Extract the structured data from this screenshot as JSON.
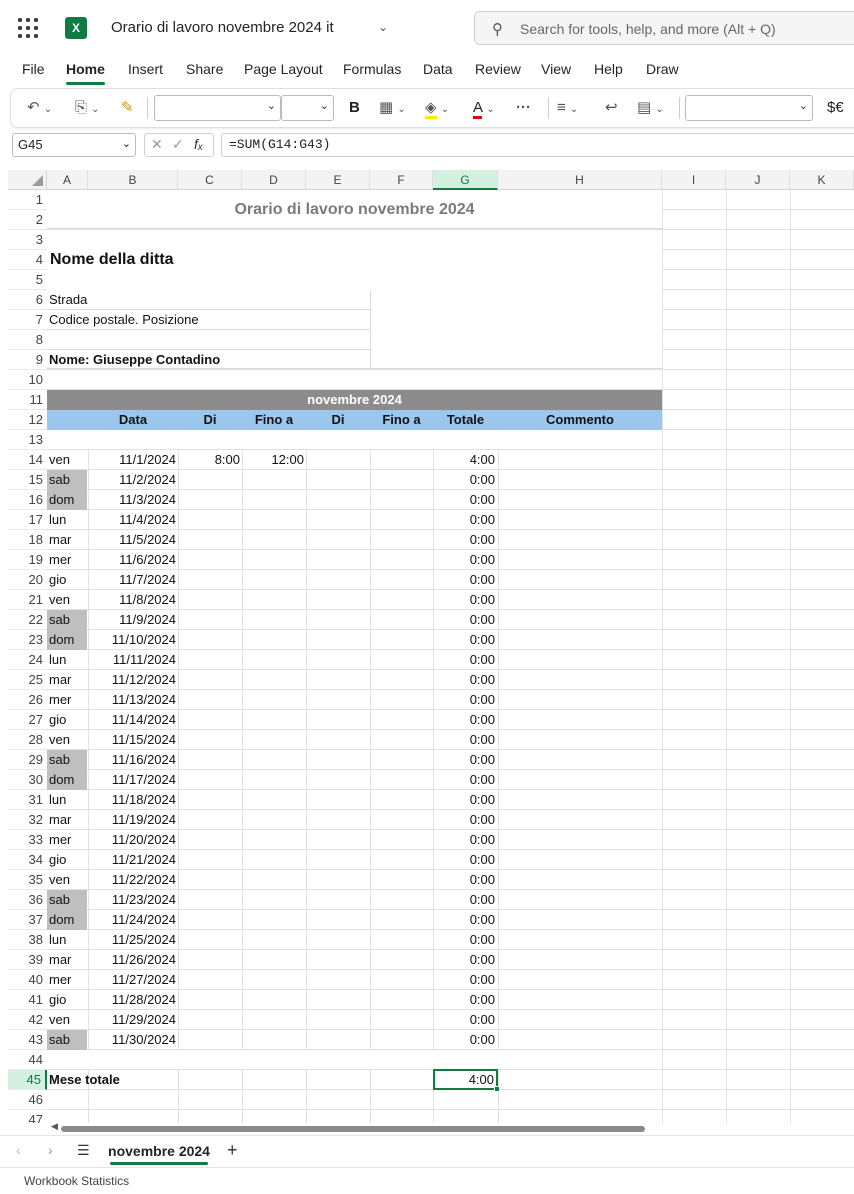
{
  "app": {
    "title": "Orario di lavoro novembre 2024 it",
    "icon": "excel-icon",
    "brand_color": "#107c41"
  },
  "search": {
    "placeholder": "Search for tools, help, and more (Alt + Q)"
  },
  "menu": [
    "File",
    "Home",
    "Insert",
    "Share",
    "Page Layout",
    "Formulas",
    "Data",
    "Review",
    "View",
    "Help",
    "Draw"
  ],
  "menu_active": "Home",
  "toolbar": {
    "bold": "B",
    "more": "···",
    "currency": "$€"
  },
  "formula_bar": {
    "cell_ref": "G45",
    "formula": "=SUM(G14:G43)",
    "fx": "fₓ"
  },
  "columns": [
    "A",
    "B",
    "C",
    "D",
    "E",
    "F",
    "G",
    "H",
    "I",
    "J",
    "K"
  ],
  "selected_column": "G",
  "selected_row": "45",
  "rows": [
    "1",
    "2",
    "3",
    "4",
    "5",
    "6",
    "7",
    "8",
    "9",
    "10",
    "11",
    "12",
    "13",
    "14",
    "15",
    "16",
    "17",
    "18",
    "19",
    "20",
    "21",
    "22",
    "23",
    "24",
    "25",
    "26",
    "27",
    "28",
    "29",
    "30",
    "31",
    "32",
    "33",
    "34",
    "35",
    "36",
    "37",
    "38",
    "39",
    "40",
    "41",
    "42",
    "43",
    "44",
    "45",
    "46",
    "47"
  ],
  "sheet": {
    "title": "Orario di lavoro novembre 2024",
    "company": "Nome della ditta",
    "street": "Strada",
    "postal": "Codice postale. Posizione",
    "name": "Nome: Giuseppe Contadino",
    "month_banner": "novembre 2024",
    "headers": {
      "data": "Data",
      "di": "Di",
      "fino_a": "Fino a",
      "di2": "Di",
      "fino_a2": "Fino a",
      "totale": "Totale",
      "commento": "Commento"
    },
    "days": [
      {
        "day": "ven",
        "date": "11/1/2024",
        "di": "8:00",
        "fino": "12:00",
        "tot": "4:00",
        "weekend": false
      },
      {
        "day": "sab",
        "date": "11/2/2024",
        "tot": "0:00",
        "weekend": true
      },
      {
        "day": "dom",
        "date": "11/3/2024",
        "tot": "0:00",
        "weekend": true
      },
      {
        "day": "lun",
        "date": "11/4/2024",
        "tot": "0:00",
        "weekend": false
      },
      {
        "day": "mar",
        "date": "11/5/2024",
        "tot": "0:00",
        "weekend": false
      },
      {
        "day": "mer",
        "date": "11/6/2024",
        "tot": "0:00",
        "weekend": false
      },
      {
        "day": "gio",
        "date": "11/7/2024",
        "tot": "0:00",
        "weekend": false
      },
      {
        "day": "ven",
        "date": "11/8/2024",
        "tot": "0:00",
        "weekend": false
      },
      {
        "day": "sab",
        "date": "11/9/2024",
        "tot": "0:00",
        "weekend": true
      },
      {
        "day": "dom",
        "date": "11/10/2024",
        "tot": "0:00",
        "weekend": true
      },
      {
        "day": "lun",
        "date": "11/11/2024",
        "tot": "0:00",
        "weekend": false
      },
      {
        "day": "mar",
        "date": "11/12/2024",
        "tot": "0:00",
        "weekend": false
      },
      {
        "day": "mer",
        "date": "11/13/2024",
        "tot": "0:00",
        "weekend": false
      },
      {
        "day": "gio",
        "date": "11/14/2024",
        "tot": "0:00",
        "weekend": false
      },
      {
        "day": "ven",
        "date": "11/15/2024",
        "tot": "0:00",
        "weekend": false
      },
      {
        "day": "sab",
        "date": "11/16/2024",
        "tot": "0:00",
        "weekend": true
      },
      {
        "day": "dom",
        "date": "11/17/2024",
        "tot": "0:00",
        "weekend": true
      },
      {
        "day": "lun",
        "date": "11/18/2024",
        "tot": "0:00",
        "weekend": false
      },
      {
        "day": "mar",
        "date": "11/19/2024",
        "tot": "0:00",
        "weekend": false
      },
      {
        "day": "mer",
        "date": "11/20/2024",
        "tot": "0:00",
        "weekend": false
      },
      {
        "day": "gio",
        "date": "11/21/2024",
        "tot": "0:00",
        "weekend": false
      },
      {
        "day": "ven",
        "date": "11/22/2024",
        "tot": "0:00",
        "weekend": false
      },
      {
        "day": "sab",
        "date": "11/23/2024",
        "tot": "0:00",
        "weekend": true
      },
      {
        "day": "dom",
        "date": "11/24/2024",
        "tot": "0:00",
        "weekend": true
      },
      {
        "day": "lun",
        "date": "11/25/2024",
        "tot": "0:00",
        "weekend": false
      },
      {
        "day": "mar",
        "date": "11/26/2024",
        "tot": "0:00",
        "weekend": false
      },
      {
        "day": "mer",
        "date": "11/27/2024",
        "tot": "0:00",
        "weekend": false
      },
      {
        "day": "gio",
        "date": "11/28/2024",
        "tot": "0:00",
        "weekend": false
      },
      {
        "day": "ven",
        "date": "11/29/2024",
        "tot": "0:00",
        "weekend": false
      },
      {
        "day": "sab",
        "date": "11/30/2024",
        "tot": "0:00",
        "weekend": true
      }
    ],
    "total_label": "Mese totale",
    "total_value": "4:00",
    "colors": {
      "banner": "#8c8c8c",
      "header": "#9bc7ef",
      "weekend": "#bfbfbf",
      "title_text": "#7a7a7a"
    }
  },
  "tabs": {
    "sheet_name": "novembre 2024",
    "add": "+"
  },
  "status": {
    "text": "Workbook Statistics"
  }
}
